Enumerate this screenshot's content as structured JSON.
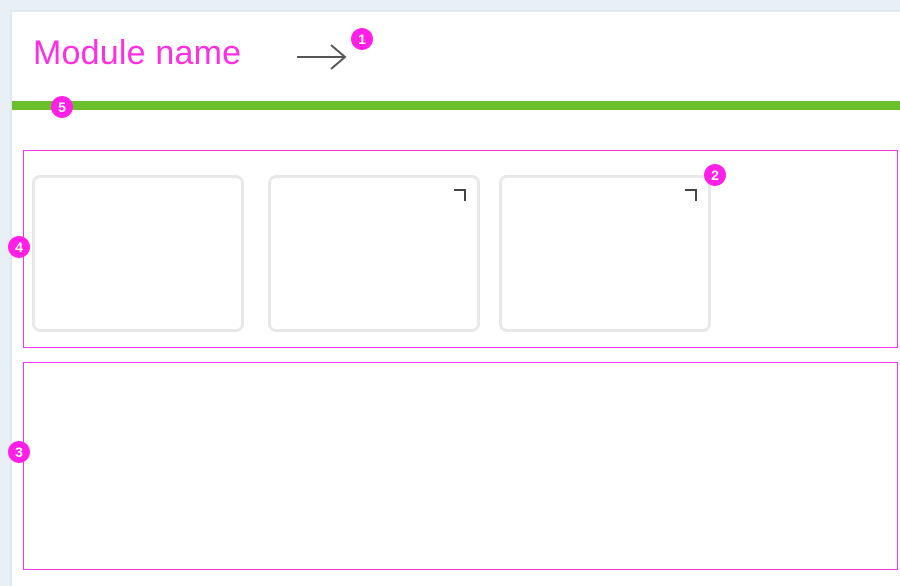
{
  "module": {
    "title": "Module name"
  },
  "annotations": [
    {
      "label": "1"
    },
    {
      "label": "2"
    },
    {
      "label": "3"
    },
    {
      "label": "4"
    },
    {
      "label": "5"
    }
  ],
  "colors": {
    "accent": "#ff2ee0",
    "progress_bar": "#6cbf2c",
    "annotation_badge": "#ff1fe6"
  },
  "icons": {
    "title_arrow": "arrow-right-icon",
    "card_corner": "expand-corner-icon"
  }
}
